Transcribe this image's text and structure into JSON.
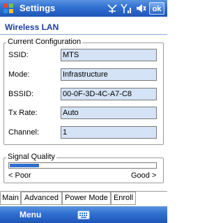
{
  "titlebar": {
    "title": "Settings",
    "ok_label": "ok"
  },
  "page": {
    "heading": "Wireless LAN"
  },
  "current_config": {
    "legend": "Current Configuration",
    "fields": [
      {
        "label": "SSID:",
        "value": "MTS"
      },
      {
        "label": "Mode:",
        "value": "Infrastructure"
      },
      {
        "label": "BSSID:",
        "value": "00-0F-3D-4C-A7-C8"
      },
      {
        "label": "Tx Rate:",
        "value": "Auto"
      },
      {
        "label": "Channel:",
        "value": "1"
      }
    ]
  },
  "signal": {
    "legend": "Signal Quality",
    "min_label": "< Poor",
    "max_label": "Good >",
    "level_percent": 20
  },
  "tabs": [
    {
      "label": "Main",
      "active": true
    },
    {
      "label": "Advanced",
      "active": false
    },
    {
      "label": "Power Mode",
      "active": false
    },
    {
      "label": "Enroll",
      "active": false
    }
  ],
  "softkeys": {
    "left": "Menu"
  },
  "colors": {
    "bar_blue": "#2f6fd0",
    "field_bg": "#d4e3f5",
    "heading": "#1c3f9a"
  }
}
